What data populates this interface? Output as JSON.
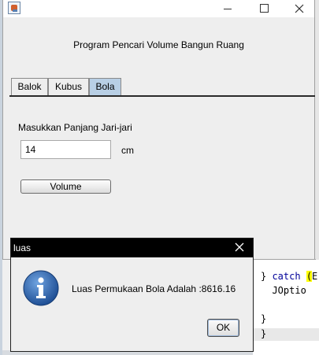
{
  "window": {
    "title": "",
    "app_title": "Program Pencari Volume Bangun Ruang",
    "controls": {
      "minimize": "minimize-icon",
      "maximize": "maximize-icon",
      "close": "close-icon"
    },
    "tabs": [
      {
        "label": "Balok",
        "selected": false
      },
      {
        "label": "Kubus",
        "selected": false
      },
      {
        "label": "Bola",
        "selected": true
      }
    ],
    "form": {
      "label": "Masukkan Panjang Jari-jari",
      "value": "14",
      "unit": "cm",
      "button_label": "Volume"
    }
  },
  "dialog": {
    "title": "luas",
    "icon": "info-icon",
    "message": "Luas Permukaan Bola Adalah :8616.16",
    "ok_label": "OK"
  },
  "ide": {
    "lines": [
      "} catch (E",
      "  JOptio",
      "}",
      "}"
    ]
  },
  "colors": {
    "tab_selected": "#b8cfe5",
    "dialog_title_bg": "#000000",
    "info_icon": "#2f6db5",
    "code_keyword": "#000099",
    "code_highlight": "#ffff00"
  }
}
